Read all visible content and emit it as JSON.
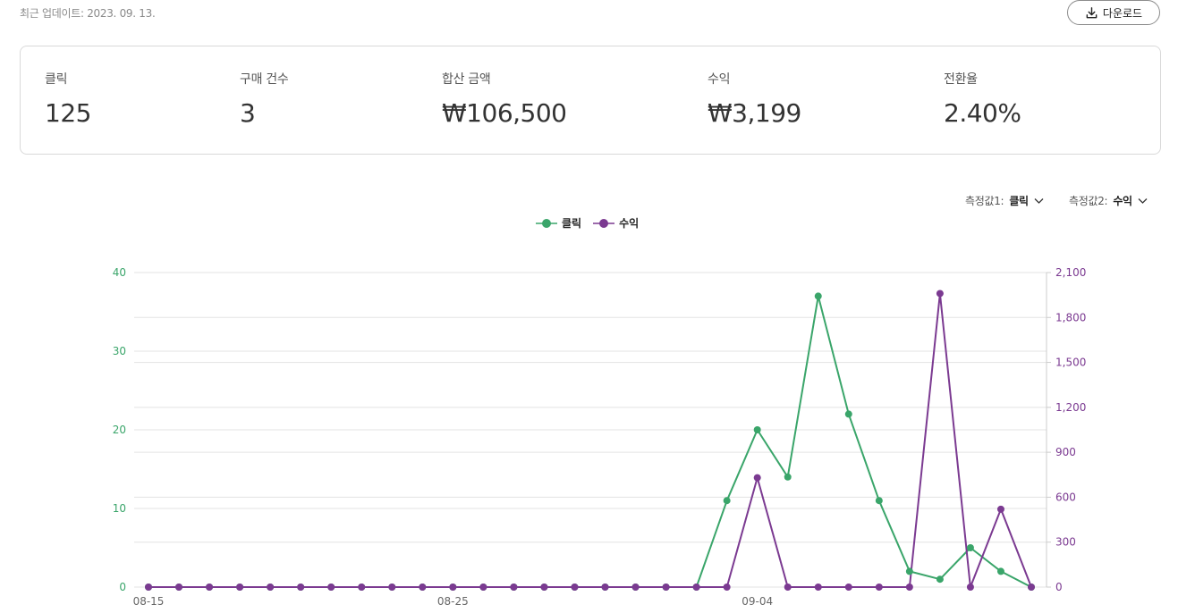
{
  "header": {
    "updated_text": "최근 업데이트: 2023. 09. 13.",
    "download_label": "다운로드"
  },
  "stats": [
    {
      "label": "클릭",
      "value": "125"
    },
    {
      "label": "구매 건수",
      "value": "3"
    },
    {
      "label": "합산 금액",
      "value": "₩106,500"
    },
    {
      "label": "수익",
      "value": "₩3,199"
    },
    {
      "label": "전환율",
      "value": "2.40%"
    }
  ],
  "controls": {
    "metric1_label": "측정값1:",
    "metric1_value": "클릭",
    "metric2_label": "측정값2:",
    "metric2_value": "수익"
  },
  "legend": [
    {
      "name": "클릭",
      "color": "#3aa56a"
    },
    {
      "name": "수익",
      "color": "#7b3a91"
    }
  ],
  "chart_data": {
    "type": "line",
    "x": [
      "08-15",
      "08-16",
      "08-17",
      "08-18",
      "08-19",
      "08-20",
      "08-21",
      "08-22",
      "08-23",
      "08-24",
      "08-25",
      "08-26",
      "08-27",
      "08-28",
      "08-29",
      "08-30",
      "08-31",
      "09-01",
      "09-02",
      "09-03",
      "09-04",
      "09-05",
      "09-06",
      "09-07",
      "09-08",
      "09-09",
      "09-10",
      "09-11",
      "09-12",
      "09-13"
    ],
    "x_tick_labels": [
      "08-15",
      "08-25",
      "09-04"
    ],
    "series": [
      {
        "name": "클릭",
        "axis": "left",
        "color": "#3aa56a",
        "values": [
          0,
          0,
          0,
          0,
          0,
          0,
          0,
          0,
          0,
          0,
          0,
          0,
          0,
          0,
          0,
          0,
          0,
          0,
          0,
          11,
          20,
          14,
          37,
          22,
          11,
          2,
          1,
          5,
          2,
          0
        ]
      },
      {
        "name": "수익",
        "axis": "right",
        "color": "#7b3a91",
        "values": [
          0,
          0,
          0,
          0,
          0,
          0,
          0,
          0,
          0,
          0,
          0,
          0,
          0,
          0,
          0,
          0,
          0,
          0,
          0,
          0,
          730,
          0,
          0,
          0,
          0,
          0,
          1960,
          0,
          520,
          0
        ]
      }
    ],
    "y_left": {
      "range": [
        0,
        40
      ],
      "ticks": [
        0,
        10,
        20,
        30,
        40
      ],
      "color": "#3aa56a"
    },
    "y_right": {
      "range": [
        0,
        2100
      ],
      "ticks": [
        "0",
        "300",
        "600",
        "900",
        "1,200",
        "1,500",
        "1,800",
        "2,100"
      ],
      "color": "#7b3a91"
    },
    "grid": true,
    "legend_position": "top-center"
  }
}
